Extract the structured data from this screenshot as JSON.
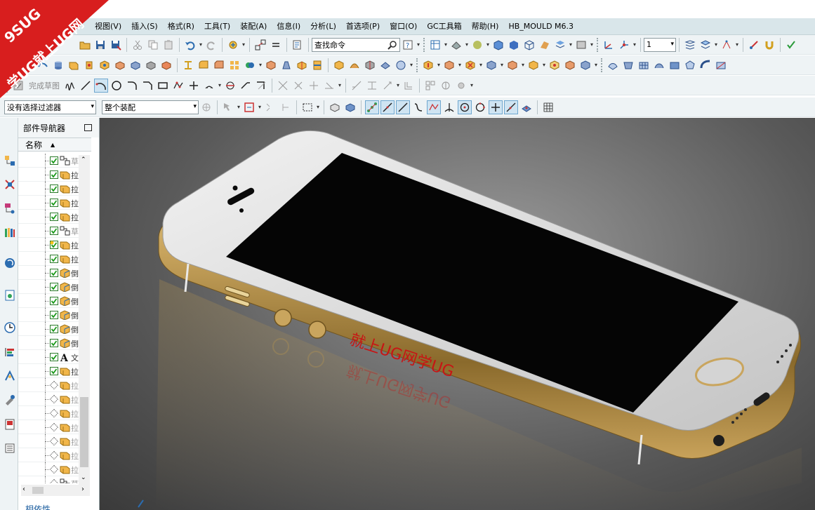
{
  "watermark": {
    "logo_top": "9SUG",
    "logo_bottom": "学UG就上UG网",
    "viewport_text": "就上UG网学UG"
  },
  "menu": [
    {
      "key": "view",
      "label": "视图(V)"
    },
    {
      "key": "insert",
      "label": "插入(S)"
    },
    {
      "key": "format",
      "label": "格式(R)"
    },
    {
      "key": "tools",
      "label": "工具(T)"
    },
    {
      "key": "assembly",
      "label": "装配(A)"
    },
    {
      "key": "info",
      "label": "信息(I)"
    },
    {
      "key": "analysis",
      "label": "分析(L)"
    },
    {
      "key": "preferences",
      "label": "首选项(P)"
    },
    {
      "key": "window",
      "label": "窗口(O)"
    },
    {
      "key": "gc-toolbox",
      "label": "GC工具箱"
    },
    {
      "key": "help",
      "label": "帮助(H)"
    },
    {
      "key": "hb-mould",
      "label": "HB_MOULD M6.3"
    }
  ],
  "toolbar": {
    "command_search_placeholder": "查找命令",
    "layer_value": "1",
    "finish_sketch_label": "完成草图",
    "selection_filter_value": "没有选择过滤器",
    "assembly_scope_value": "整个装配"
  },
  "navigator": {
    "title": "部件导航器",
    "column_name": "名称",
    "bottom_label": "相依性",
    "rows": [
      {
        "state": "checked",
        "icon": "sketch-icon",
        "label": "草",
        "dim": true
      },
      {
        "state": "checked",
        "icon": "extrude-icon",
        "label": "拉"
      },
      {
        "state": "checked",
        "icon": "extrude-icon",
        "label": "拉"
      },
      {
        "state": "checked",
        "icon": "extrude-icon",
        "label": "拉"
      },
      {
        "state": "checked",
        "icon": "extrude-icon",
        "label": "拉"
      },
      {
        "state": "checked",
        "icon": "sketch-icon",
        "label": "草",
        "dim": true
      },
      {
        "state": "warning",
        "icon": "extrude-icon",
        "label": "拉"
      },
      {
        "state": "checked",
        "icon": "extrude-icon",
        "label": "拉"
      },
      {
        "state": "checked",
        "icon": "body-icon",
        "label": "倒"
      },
      {
        "state": "checked",
        "icon": "body-icon",
        "label": "倒"
      },
      {
        "state": "checked",
        "icon": "body-icon",
        "label": "倒"
      },
      {
        "state": "checked",
        "icon": "body-icon",
        "label": "倒"
      },
      {
        "state": "checked",
        "icon": "body-icon",
        "label": "倒"
      },
      {
        "state": "checked",
        "icon": "body-icon",
        "label": "倒"
      },
      {
        "state": "checked",
        "icon": "text-icon",
        "label": "文"
      },
      {
        "state": "checked",
        "icon": "extrude-icon",
        "label": "拉"
      },
      {
        "state": "suppressed",
        "icon": "extrude-icon",
        "label": "拉",
        "dim": true
      },
      {
        "state": "suppressed",
        "icon": "extrude-icon",
        "label": "拉",
        "dim": true
      },
      {
        "state": "suppressed",
        "icon": "extrude-icon",
        "label": "拉",
        "dim": true
      },
      {
        "state": "suppressed",
        "icon": "extrude-icon",
        "label": "拉",
        "dim": true
      },
      {
        "state": "suppressed",
        "icon": "extrude-icon",
        "label": "拉",
        "dim": true
      },
      {
        "state": "suppressed",
        "icon": "extrude-icon",
        "label": "拉",
        "dim": true
      },
      {
        "state": "suppressed",
        "icon": "extrude-icon",
        "label": "拉",
        "dim": true
      },
      {
        "state": "suppressed",
        "icon": "sketch-icon",
        "label": "草",
        "dim": true
      }
    ]
  },
  "colors": {
    "menubar": "#d9e6ea",
    "toolbar": "#eef3f5",
    "phone_gold": "#c9a55e",
    "phone_silver": "#d8d8d8",
    "screen": "#050505",
    "watermark_red": "#c81414"
  }
}
